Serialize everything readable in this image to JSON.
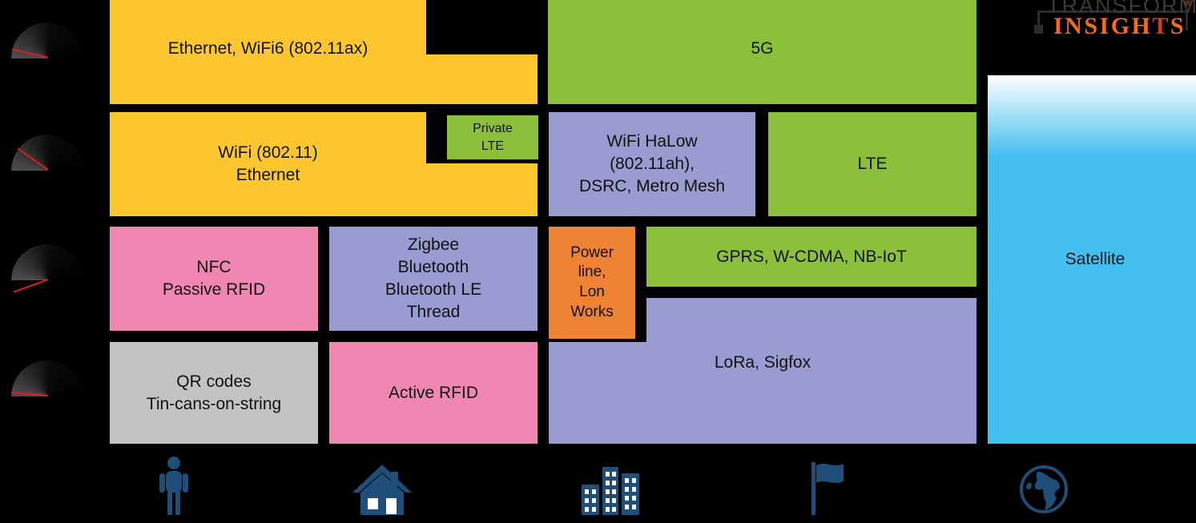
{
  "brand": {
    "line1": "TRANSFORMA",
    "line2_pre": "INSIGH",
    "line2_t": "T",
    "line2_post": "S",
    "registered": "®"
  },
  "colors": {
    "background": "#000000",
    "yellow": "#FCC72E",
    "green": "#8CC03B",
    "purple": "#9A9BD0",
    "pink": "#F087B3",
    "orange": "#F08234",
    "grey": "#C3C3C3",
    "satellite_top": "#FFFFFF",
    "satellite_bottom": "#42BFEF",
    "icon_blue": "#1F4E79",
    "needle_red": "#D81F26"
  },
  "blocks": [
    {
      "id": "ethernet-wifi6",
      "label": "Ethernet, WiFi6 (802.11ax)",
      "color": "yellow"
    },
    {
      "id": "5g",
      "label": "5G",
      "color": "green"
    },
    {
      "id": "wifi-ethernet",
      "label": "WiFi (802.11)\nEthernet",
      "color": "yellow"
    },
    {
      "id": "private-lte",
      "label": "Private\nLTE",
      "color": "green"
    },
    {
      "id": "wifi-halow",
      "label": "WiFi HaLow\n(802.11ah),\nDSRC, Metro Mesh",
      "color": "purple"
    },
    {
      "id": "lte",
      "label": "LTE",
      "color": "green"
    },
    {
      "id": "nfc-passive-rfid",
      "label": "NFC\nPassive RFID",
      "color": "pink"
    },
    {
      "id": "zigbee-bluetooth",
      "label": "Zigbee\nBluetooth\nBluetooth LE\nThread",
      "color": "purple"
    },
    {
      "id": "powerline-lonworks",
      "label": "Power\nline,\nLon\nWorks",
      "color": "orange"
    },
    {
      "id": "gprs-wcdma-nbiot",
      "label": "GPRS, W-CDMA, NB-IoT",
      "color": "green"
    },
    {
      "id": "lora-sigfox",
      "label": "LoRa, Sigfox",
      "color": "purple"
    },
    {
      "id": "qr-codes",
      "label": "QR codes\nTin-cans-on-string",
      "color": "grey"
    },
    {
      "id": "active-rfid",
      "label": "Active RFID",
      "color": "pink"
    },
    {
      "id": "satellite",
      "label": "Satellite",
      "color": "satellite"
    }
  ],
  "range_icons": [
    {
      "id": "range-gauge-1",
      "name": "speed-gauge-icon"
    },
    {
      "id": "range-gauge-2",
      "name": "speed-gauge-icon"
    },
    {
      "id": "range-gauge-3",
      "name": "speed-gauge-icon"
    },
    {
      "id": "range-gauge-4",
      "name": "speed-gauge-icon"
    }
  ],
  "scope_icons": [
    {
      "id": "scope-person",
      "name": "person-icon"
    },
    {
      "id": "scope-home",
      "name": "house-icon"
    },
    {
      "id": "scope-city",
      "name": "city-buildings-icon"
    },
    {
      "id": "scope-nation",
      "name": "flag-icon"
    },
    {
      "id": "scope-global",
      "name": "globe-icon"
    }
  ]
}
